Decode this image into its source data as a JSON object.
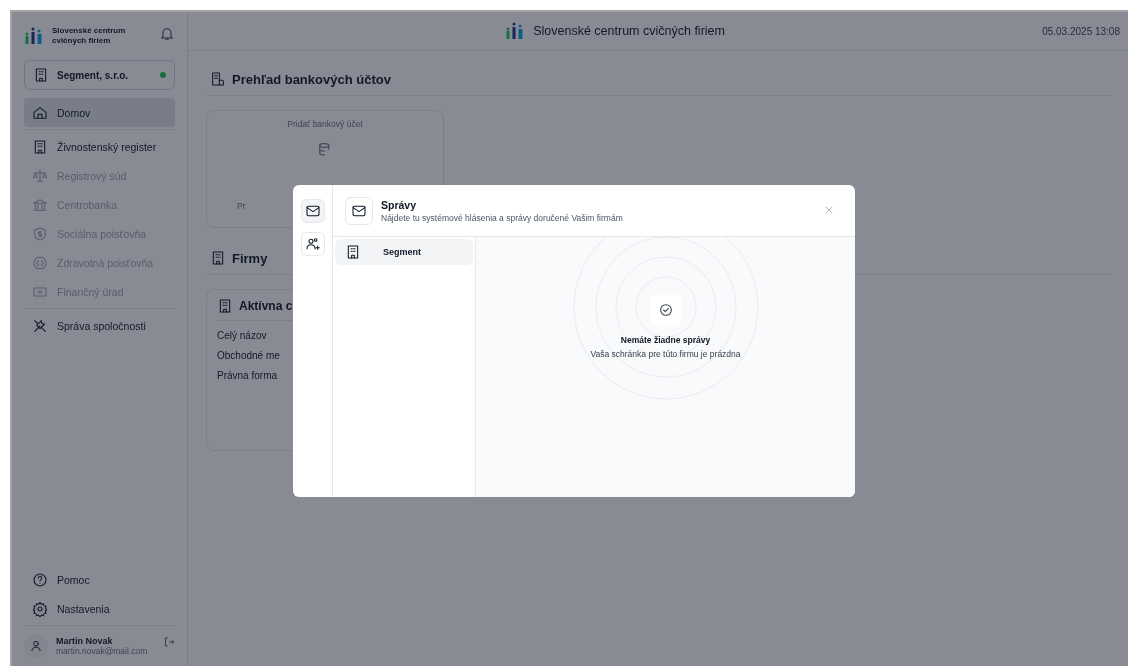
{
  "sidebar": {
    "brand": "Slovenské centrum cvičných firiem",
    "company": {
      "name": "Segment, s.r.o.",
      "online": true
    },
    "nav": [
      {
        "label": "Domov",
        "selected": true,
        "disabled": false
      },
      {
        "label": "Živnostenský register",
        "selected": false,
        "disabled": false
      },
      {
        "label": "Registrový súd",
        "selected": false,
        "disabled": true
      },
      {
        "label": "Centrobanka",
        "selected": false,
        "disabled": true
      },
      {
        "label": "Sociálna poisťovňa",
        "selected": false,
        "disabled": true
      },
      {
        "label": "Zdravotná poisťovňa",
        "selected": false,
        "disabled": true
      },
      {
        "label": "Finančný úrad",
        "selected": false,
        "disabled": true
      },
      {
        "label": "Správa spoločnosti",
        "selected": false,
        "disabled": false
      }
    ],
    "bottom": [
      {
        "label": "Pomoc"
      },
      {
        "label": "Nastavenia"
      }
    ],
    "user": {
      "name": "Martin Novak",
      "email": "martin.novak@mail.com"
    }
  },
  "header": {
    "title": "Slovenské centrum cvičných firiem",
    "datetime": "05.03.2025 13:08"
  },
  "main": {
    "bank_title": "Prehľad bankových účtov",
    "add_account": "Pridať bankový účet",
    "add_hint": "Pr",
    "firms_title": "Firmy",
    "active_title": "Aktívna c",
    "fields": [
      "Celý názov",
      "Obchodné me",
      "Právna forma"
    ]
  },
  "modal": {
    "rail": [
      {
        "selected": true
      },
      {
        "selected": false
      }
    ],
    "title": "Správy",
    "subtitle": "Nájdete tu systémové hlásenia a správy doručené Vašim firmám",
    "firms": [
      {
        "name": "Segment",
        "selected": true
      }
    ],
    "empty_title": "Nemáte žiadne správy",
    "empty_text": "Vaša schránka pre túto firmu je prázdna"
  }
}
